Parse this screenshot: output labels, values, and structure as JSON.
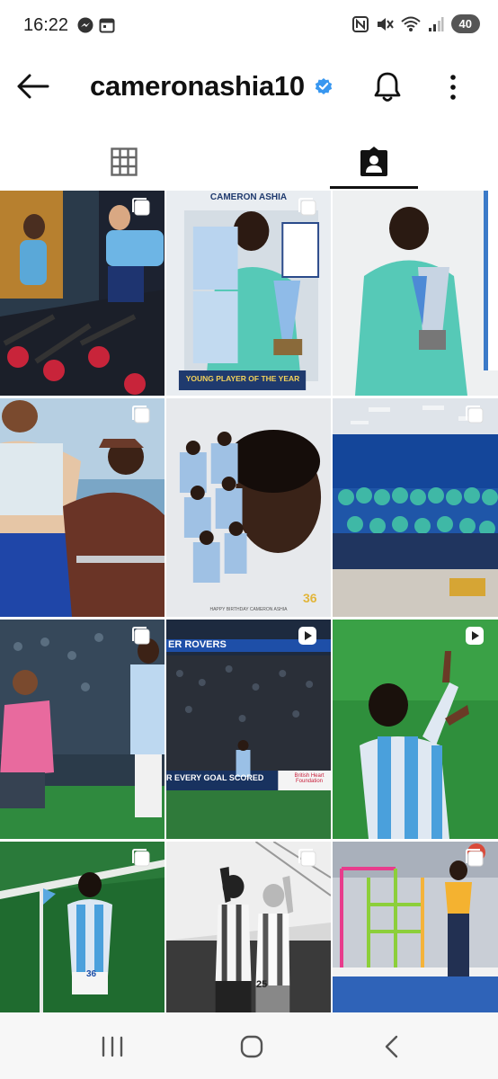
{
  "status_bar": {
    "time": "16:22",
    "battery": "40",
    "left_icons": [
      "messenger-icon",
      "calendar-icon"
    ],
    "right_icons": [
      "nfc-icon",
      "mute-icon",
      "wifi-icon",
      "signal-icon"
    ]
  },
  "header": {
    "username": "cameronashia10",
    "verified": true,
    "accent": "#3897f0"
  },
  "tabs": [
    {
      "name": "posts-grid",
      "icon": "grid-icon",
      "active": false
    },
    {
      "name": "tagged",
      "icon": "tagged-person-icon",
      "active": true
    }
  ],
  "posts": [
    {
      "id": 1,
      "badge": "carousel-icon",
      "texts": []
    },
    {
      "id": 2,
      "badge": "carousel-icon",
      "texts": [
        "CAMERON ASHIA",
        "YOUNG PLAYER OF THE YEAR"
      ]
    },
    {
      "id": 3,
      "badge": "none",
      "texts": []
    },
    {
      "id": 4,
      "badge": "carousel-icon",
      "texts": []
    },
    {
      "id": 5,
      "badge": "none",
      "texts": [
        "36",
        "HAPPY BIRTHDAY CAMERON ASHIA"
      ]
    },
    {
      "id": 6,
      "badge": "carousel-icon",
      "texts": []
    },
    {
      "id": 7,
      "badge": "carousel-icon",
      "texts": []
    },
    {
      "id": 8,
      "badge": "reel-icon",
      "texts": [
        "ER ROVERS",
        "R EVERY GOAL SCORED",
        "British Heart Foundation"
      ]
    },
    {
      "id": 9,
      "badge": "reel-icon",
      "texts": []
    },
    {
      "id": 10,
      "badge": "carousel-icon",
      "texts": [
        "36"
      ]
    },
    {
      "id": 11,
      "badge": "carousel-icon",
      "texts": [
        "25"
      ]
    },
    {
      "id": 12,
      "badge": "carousel-icon",
      "texts": []
    }
  ],
  "navbar": {
    "buttons": [
      "recents-button",
      "home-button",
      "back-button"
    ]
  }
}
